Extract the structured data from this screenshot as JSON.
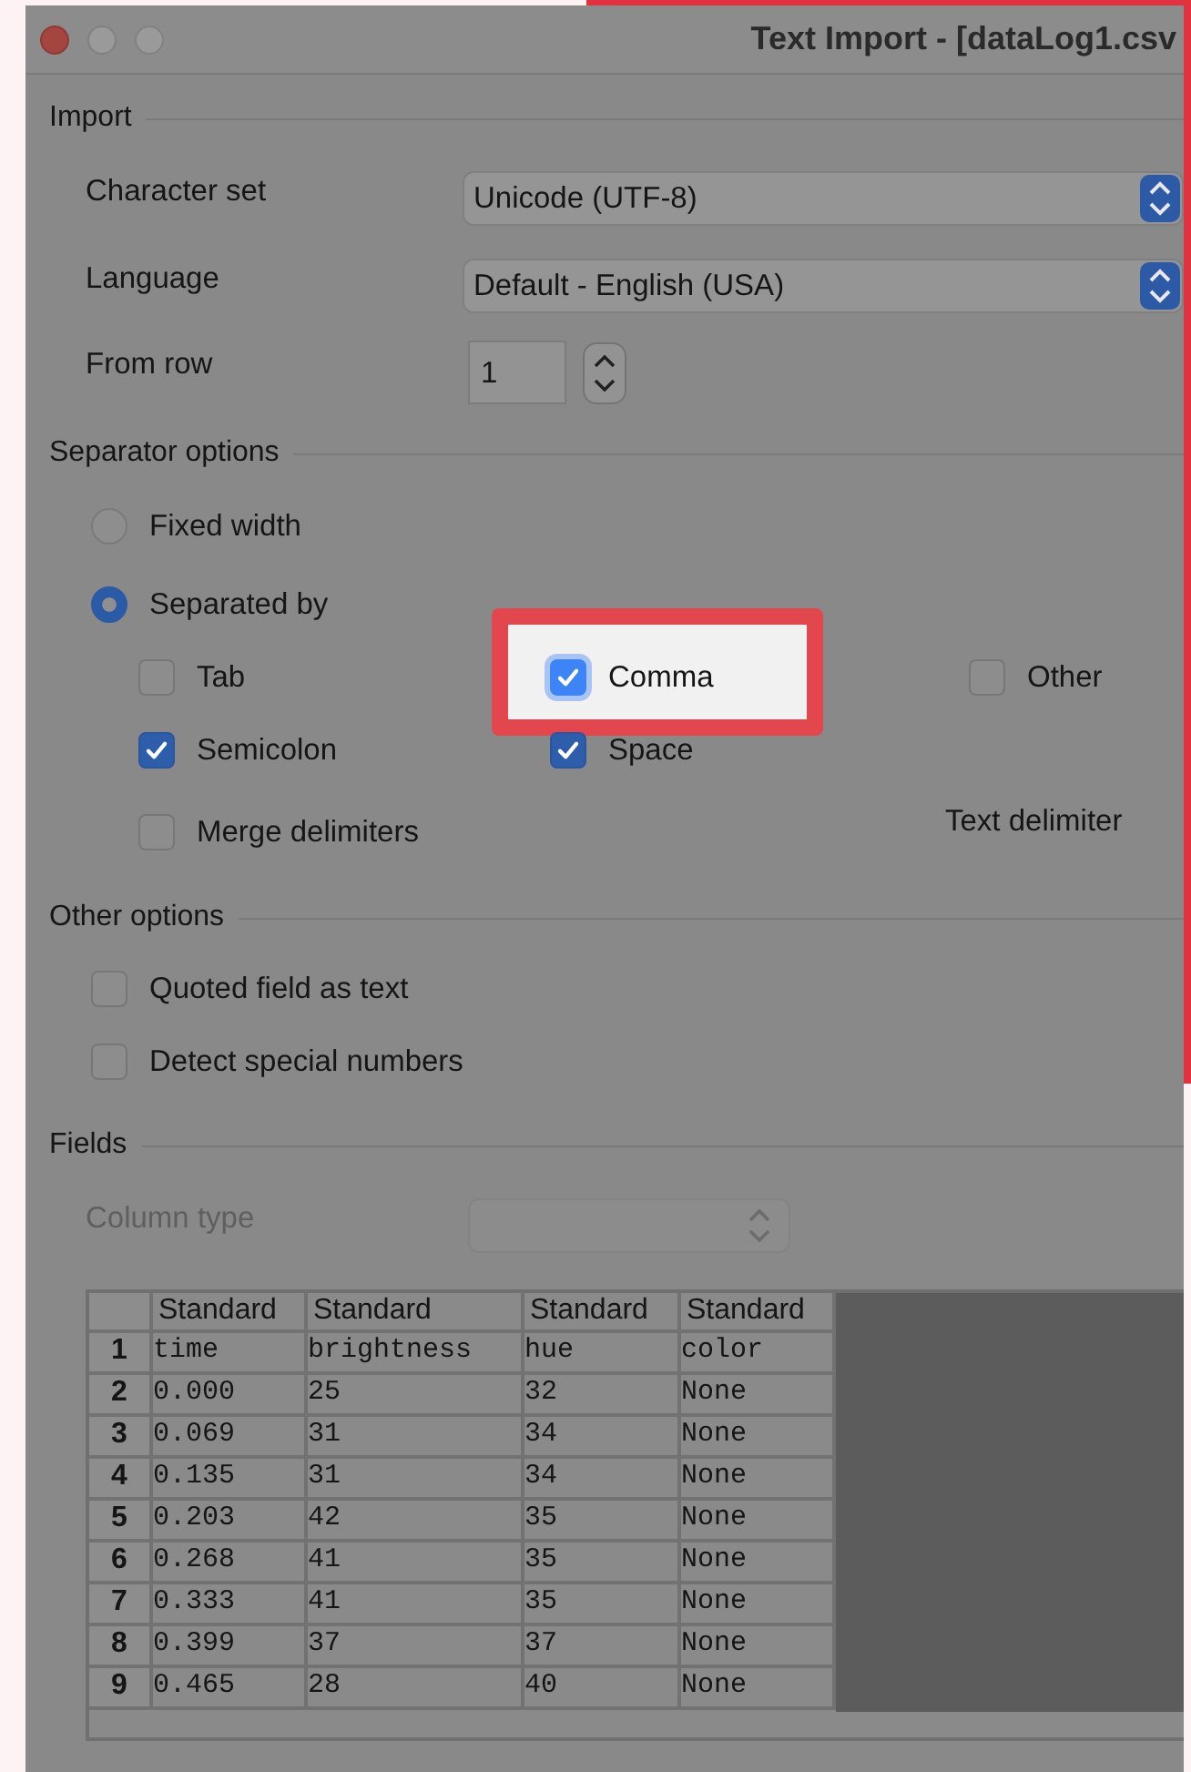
{
  "window": {
    "title": "Text Import - [dataLog1.csv"
  },
  "import": {
    "heading": "Import",
    "fields": [
      {
        "label": "Character set",
        "kind": "popup",
        "value": "Unicode (UTF-8)"
      },
      {
        "label": "Language",
        "kind": "popup",
        "value": "Default - English (USA)"
      },
      {
        "label": "From row",
        "kind": "spin",
        "value": "1"
      }
    ]
  },
  "separator_options": {
    "heading": "Separator options",
    "modes": [
      {
        "label": "Fixed width",
        "selected": false
      },
      {
        "label": "Separated by",
        "selected": true
      }
    ],
    "rows": [
      {
        "items": [
          {
            "label": "Tab",
            "checked": false,
            "highlighted": false
          },
          {
            "label": "Comma",
            "checked": true,
            "highlighted": true
          },
          {
            "label": "Other",
            "checked": false,
            "highlighted": false
          }
        ]
      },
      {
        "items": [
          {
            "label": "Semicolon",
            "checked": true,
            "highlighted": false
          },
          {
            "label": "Space",
            "checked": true,
            "highlighted": false
          }
        ]
      }
    ],
    "merge_delimiters": {
      "label": "Merge delimiters",
      "checked": false
    },
    "text_delimiter": "Text delimiter"
  },
  "other_options": {
    "heading": "Other options",
    "items": [
      {
        "label": "Quoted field as text",
        "checked": false
      },
      {
        "label": "Detect special numbers",
        "checked": false
      }
    ]
  },
  "fields": {
    "heading": "Fields",
    "column_type": {
      "label": "Column type",
      "disabled": true
    },
    "table": {
      "columns": [
        "Standard",
        "Standard",
        "Standard",
        "Standard"
      ],
      "rows": [
        {
          "number": "1",
          "cells": [
            "time",
            "brightness",
            "hue",
            "color"
          ]
        },
        {
          "number": "2",
          "cells": [
            "0.000",
            "25",
            "32",
            "None"
          ]
        },
        {
          "number": "3",
          "cells": [
            "0.069",
            "31",
            "34",
            "None"
          ]
        },
        {
          "number": "4",
          "cells": [
            "0.135",
            "31",
            "34",
            "None"
          ]
        },
        {
          "number": "5",
          "cells": [
            "0.203",
            "42",
            "35",
            "None"
          ]
        },
        {
          "number": "6",
          "cells": [
            "0.268",
            "41",
            "35",
            "None"
          ]
        },
        {
          "number": "7",
          "cells": [
            "0.333",
            "41",
            "35",
            "None"
          ]
        },
        {
          "number": "8",
          "cells": [
            "0.399",
            "37",
            "37",
            "None"
          ]
        },
        {
          "number": "9",
          "cells": [
            "0.465",
            "28",
            "40",
            "None"
          ]
        }
      ]
    }
  }
}
